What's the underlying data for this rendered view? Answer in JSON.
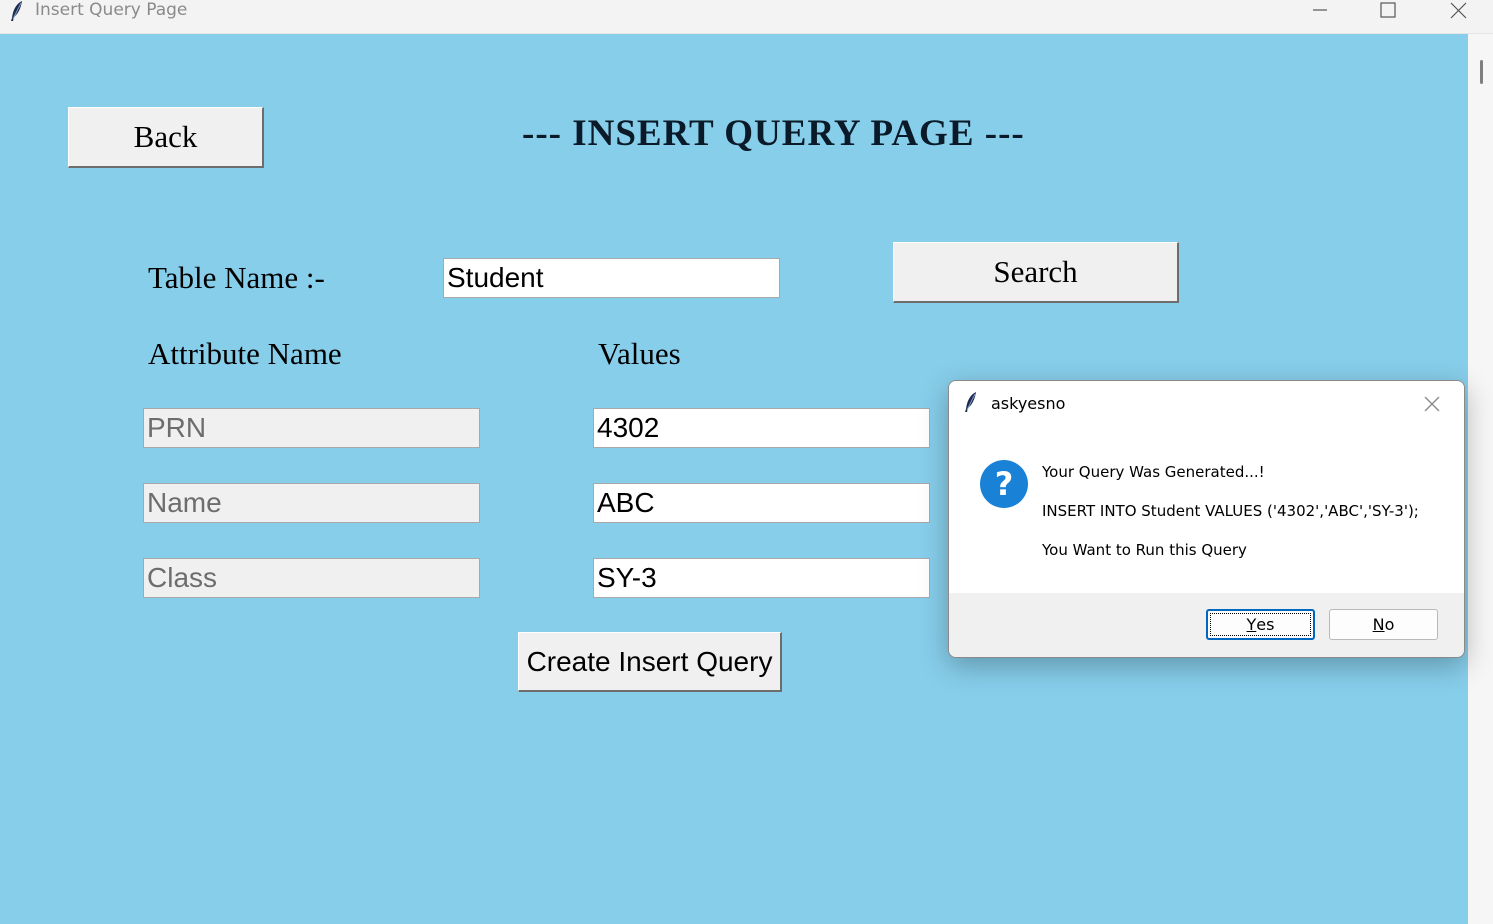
{
  "window": {
    "title": "Insert Query Page",
    "icon": "feather-icon",
    "controls": [
      "minimize-icon",
      "maximize-icon",
      "close-icon"
    ]
  },
  "colors": {
    "background": "#87ceeb",
    "dialog_accent": "#0067c0",
    "question_icon": "#1a82d6"
  },
  "page": {
    "back_label": "Back",
    "heading": "--- INSERT QUERY PAGE ---",
    "table_name_label": "Table Name :-",
    "table_name_value": "Student",
    "search_label": "Search",
    "attr_header": "Attribute Name",
    "values_header": "Values",
    "rows": [
      {
        "attribute": "PRN",
        "value": "4302"
      },
      {
        "attribute": "Name",
        "value": "ABC"
      },
      {
        "attribute": "Class",
        "value": "SY-3"
      }
    ],
    "create_label": "Create Insert Query"
  },
  "dialog": {
    "title": "askyesno",
    "icon": "question-icon",
    "line1": "Your Query Was Generated...!",
    "line2": "INSERT INTO Student VALUES ('4302','ABC','SY-3');",
    "line3": "You Want to Run this Query",
    "yes_mnemonic": "Y",
    "yes_rest": "es",
    "no_mnemonic": "N",
    "no_rest": "o"
  }
}
